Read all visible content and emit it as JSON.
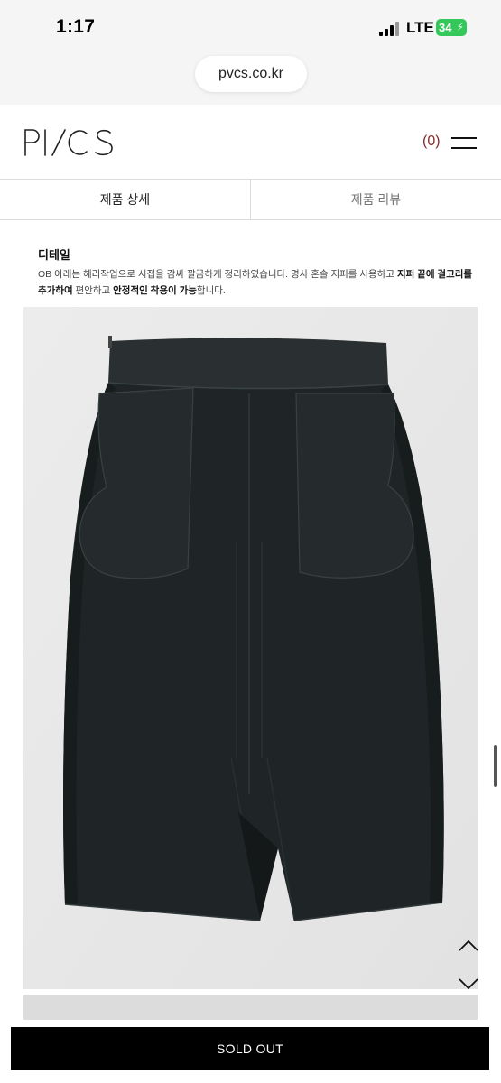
{
  "status_bar": {
    "time": "1:17",
    "network": "LTE",
    "battery": "34"
  },
  "browser": {
    "url": "pvcs.co.kr"
  },
  "header": {
    "logo": "PVCS",
    "cart_count": "(0)"
  },
  "tabs": [
    {
      "label": "제품 상세",
      "active": true
    },
    {
      "label": "제품 리뷰",
      "active": false
    }
  ],
  "detail": {
    "title": "디테일",
    "line1_normal": "OB 아래는 헤리작업으로 시접을 감싸 깔끔하게 정리하였습니다. 명사 혼솔 지퍼를 사용하고 ",
    "line1_bold": "지퍼 끝에 걸고리를",
    "line2_bold_a": "추가하여",
    "line2_normal_a": " 편안하고 ",
    "line2_bold_b": "안정적인 착용이 가능",
    "line2_normal_b": "합니다."
  },
  "actions": {
    "sold_out": "SOLD OUT"
  },
  "icons": {
    "menu": "hamburger-icon",
    "scroll_up": "chevron-up-icon",
    "scroll_down": "chevron-down-icon",
    "signal": "cellular-signal-icon",
    "battery": "battery-icon"
  },
  "colors": {
    "cart_count": "#8a2a2a",
    "button_bg": "#000000",
    "battery": "#34c759",
    "skirt": "#1f2526"
  }
}
